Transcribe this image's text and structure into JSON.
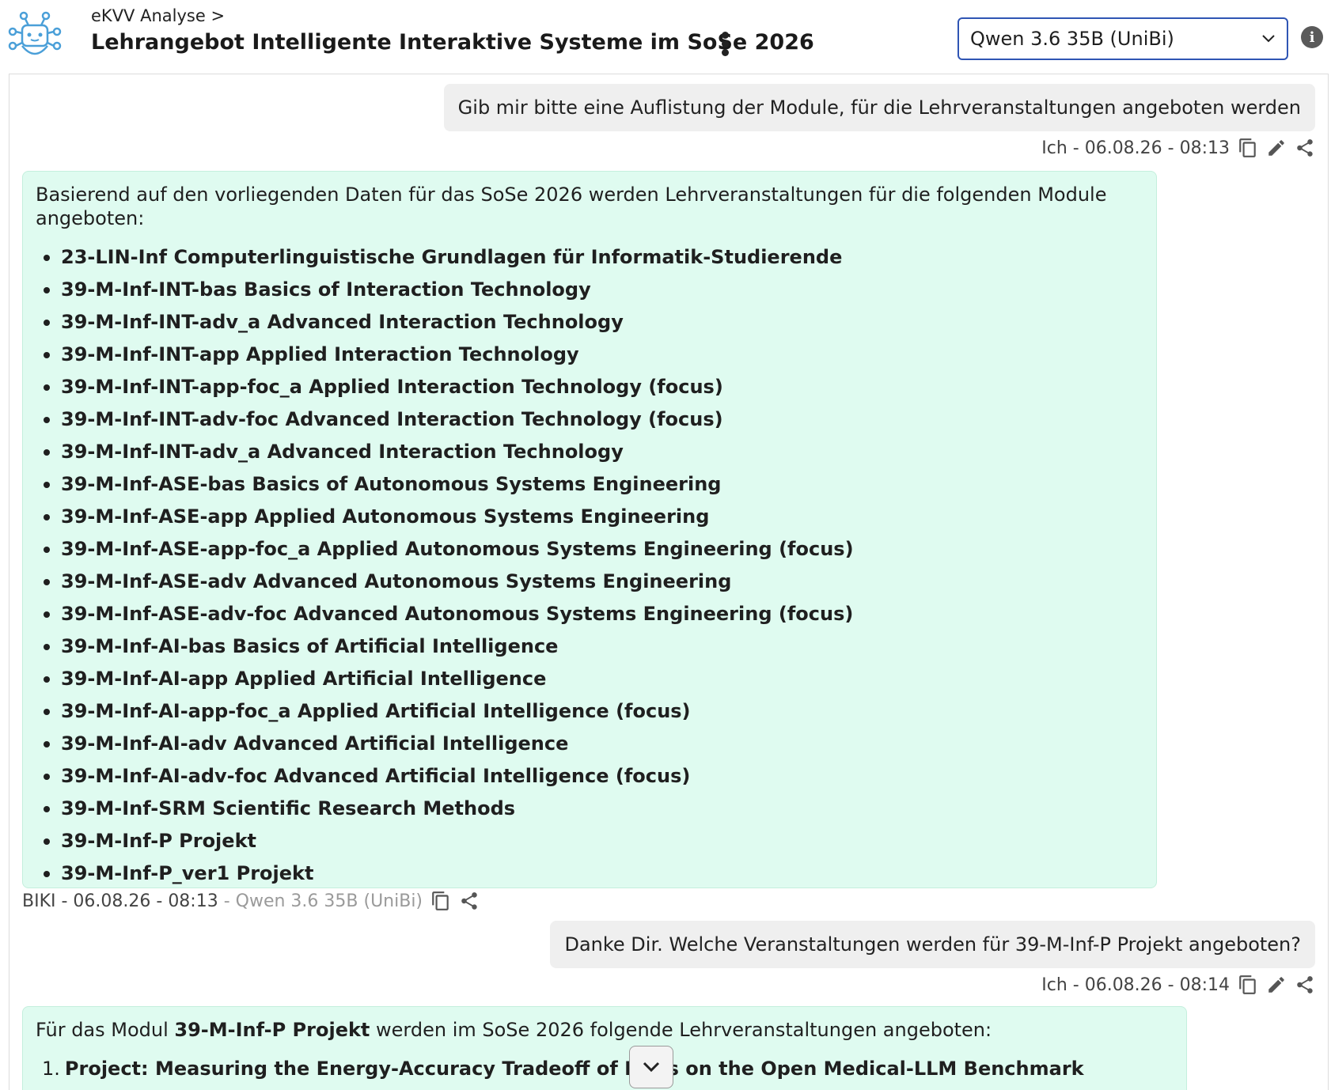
{
  "header": {
    "breadcrumb": "eKVV Analyse >",
    "title": "Lehrangebot Intelligente Interaktive Systeme im SoSe 2026",
    "model_selected": "Qwen 3.6 35B (UniBi)"
  },
  "messages": {
    "user1": {
      "text": "Gib mir bitte eine Auflistung der Module, für die Lehrveranstaltungen angeboten werden",
      "meta": "Ich - 06.08.26 - 08:13"
    },
    "bot1": {
      "intro": "Basierend auf den vorliegenden Daten für das SoSe 2026 werden Lehrveranstaltungen für die folgenden Module angeboten:",
      "items": [
        "23-LIN-Inf Computerlinguistische Grundlagen für Informatik-Studierende",
        "39-M-Inf-INT-bas Basics of Interaction Technology",
        "39-M-Inf-INT-adv_a Advanced Interaction Technology",
        "39-M-Inf-INT-app Applied Interaction Technology",
        "39-M-Inf-INT-app-foc_a Applied Interaction Technology (focus)",
        "39-M-Inf-INT-adv-foc Advanced Interaction Technology (focus)",
        "39-M-Inf-INT-adv_a Advanced Interaction Technology",
        "39-M-Inf-ASE-bas Basics of Autonomous Systems Engineering",
        "39-M-Inf-ASE-app Applied Autonomous Systems Engineering",
        "39-M-Inf-ASE-app-foc_a Applied Autonomous Systems Engineering (focus)",
        "39-M-Inf-ASE-adv Advanced Autonomous Systems Engineering",
        "39-M-Inf-ASE-adv-foc Advanced Autonomous Systems Engineering (focus)",
        "39-M-Inf-AI-bas Basics of Artificial Intelligence",
        "39-M-Inf-AI-app Applied Artificial Intelligence",
        "39-M-Inf-AI-app-foc_a Applied Artificial Intelligence (focus)",
        "39-M-Inf-AI-adv Advanced Artificial Intelligence",
        "39-M-Inf-AI-adv-foc Advanced Artificial Intelligence (focus)",
        "39-M-Inf-SRM Scientific Research Methods",
        "39-M-Inf-P Projekt",
        "39-M-Inf-P_ver1 Projekt"
      ],
      "meta": "BIKI - 06.08.26 - 08:13",
      "meta_model": " - Qwen 3.6 35B (UniBi)"
    },
    "user2": {
      "text": "Danke Dir. Welche Veranstaltungen werden für 39-M-Inf-P Projekt angeboten?",
      "meta": "Ich - 06.08.26 - 08:14"
    },
    "bot2": {
      "intro_pre": "Für das Modul ",
      "intro_bold": "39-M-Inf-P Projekt",
      "intro_post": " werden im SoSe 2026 folgende Lehrveranstaltungen angeboten:",
      "items": [
        {
          "num": "1.",
          "text": "Project: Measuring the Energy-Accuracy Tradeoff of LLMs on the Open Medical-LLM Benchmark"
        }
      ]
    }
  }
}
